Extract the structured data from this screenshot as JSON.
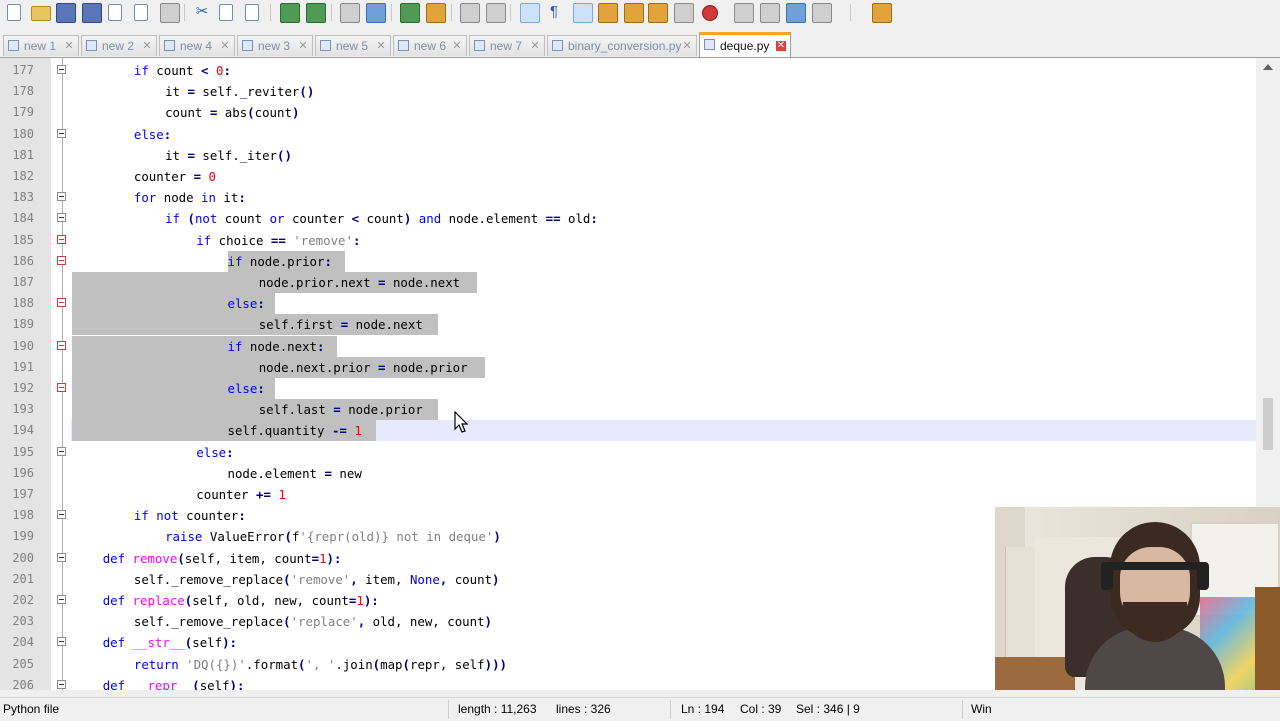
{
  "tabs": [
    {
      "label": "new 1",
      "active": false
    },
    {
      "label": "new 2",
      "active": false
    },
    {
      "label": "new 4",
      "active": false
    },
    {
      "label": "new 3",
      "active": false
    },
    {
      "label": "new 5",
      "active": false
    },
    {
      "label": "new 6",
      "active": false
    },
    {
      "label": "new 7",
      "active": false
    },
    {
      "label": "binary_conversion.py",
      "active": false
    },
    {
      "label": "deque.py",
      "active": true
    }
  ],
  "editor": {
    "current_line": 194,
    "selection_lines": [
      186,
      194
    ],
    "lines": [
      {
        "num": "177",
        "fold": true,
        "foldColor": "gray",
        "indent": 8,
        "tokens": [
          [
            "kw",
            "if"
          ],
          [
            "t",
            " count "
          ],
          [
            "op",
            "<"
          ],
          [
            "t",
            " "
          ],
          [
            "num",
            "0"
          ],
          [
            "op",
            ":"
          ]
        ]
      },
      {
        "num": "178",
        "indent": 12,
        "tokens": [
          [
            "t",
            "it "
          ],
          [
            "op",
            "="
          ],
          [
            "t",
            " self."
          ],
          [
            "t",
            "_reviter"
          ],
          [
            "op",
            "()"
          ]
        ]
      },
      {
        "num": "179",
        "indent": 12,
        "tokens": [
          [
            "t",
            "count "
          ],
          [
            "op",
            "="
          ],
          [
            "t",
            " abs"
          ],
          [
            "op",
            "("
          ],
          [
            "t",
            "count"
          ],
          [
            "op",
            ")"
          ]
        ]
      },
      {
        "num": "180",
        "fold": true,
        "foldColor": "gray",
        "indent": 8,
        "tokens": [
          [
            "kw",
            "else"
          ],
          [
            "op",
            ":"
          ]
        ]
      },
      {
        "num": "181",
        "indent": 12,
        "tokens": [
          [
            "t",
            "it "
          ],
          [
            "op",
            "="
          ],
          [
            "t",
            " self."
          ],
          [
            "t",
            "_iter"
          ],
          [
            "op",
            "()"
          ]
        ]
      },
      {
        "num": "182",
        "indent": 8,
        "tokens": [
          [
            "t",
            "counter "
          ],
          [
            "op",
            "="
          ],
          [
            "t",
            " "
          ],
          [
            "num",
            "0"
          ]
        ]
      },
      {
        "num": "183",
        "fold": true,
        "foldColor": "gray",
        "indent": 8,
        "tokens": [
          [
            "kw",
            "for"
          ],
          [
            "t",
            " node "
          ],
          [
            "kw",
            "in"
          ],
          [
            "t",
            " it"
          ],
          [
            "op",
            ":"
          ]
        ]
      },
      {
        "num": "184",
        "fold": true,
        "foldColor": "gray",
        "indent": 12,
        "tokens": [
          [
            "kw",
            "if"
          ],
          [
            "t",
            " "
          ],
          [
            "op",
            "("
          ],
          [
            "kw",
            "not"
          ],
          [
            "t",
            " count "
          ],
          [
            "kw",
            "or"
          ],
          [
            "t",
            " counter "
          ],
          [
            "op",
            "<"
          ],
          [
            "t",
            " count"
          ],
          [
            "op",
            ")"
          ],
          [
            "t",
            " "
          ],
          [
            "kw",
            "and"
          ],
          [
            "t",
            " node.element "
          ],
          [
            "op",
            "=="
          ],
          [
            "t",
            " old"
          ],
          [
            "op",
            ":"
          ]
        ]
      },
      {
        "num": "185",
        "fold": true,
        "foldColor": "red",
        "indent": 16,
        "tokens": [
          [
            "kw",
            "if"
          ],
          [
            "t",
            " choice "
          ],
          [
            "op",
            "=="
          ],
          [
            "t",
            " "
          ],
          [
            "str",
            "'remove'"
          ],
          [
            "op",
            ":"
          ]
        ]
      },
      {
        "num": "186",
        "fold": true,
        "foldColor": "red",
        "indent": 20,
        "tokens": [
          [
            "kw",
            "if"
          ],
          [
            "t",
            " node.prior"
          ],
          [
            "op",
            ":"
          ]
        ]
      },
      {
        "num": "187",
        "indent": 24,
        "tokens": [
          [
            "t",
            "node.prior.next "
          ],
          [
            "op",
            "="
          ],
          [
            "t",
            " node.next"
          ]
        ]
      },
      {
        "num": "188",
        "fold": true,
        "foldColor": "red",
        "indent": 20,
        "tokens": [
          [
            "kw",
            "else"
          ],
          [
            "op",
            ":"
          ]
        ]
      },
      {
        "num": "189",
        "indent": 24,
        "tokens": [
          [
            "t",
            "self.first "
          ],
          [
            "op",
            "="
          ],
          [
            "t",
            " node.next"
          ]
        ]
      },
      {
        "num": "190",
        "fold": true,
        "foldColor": "red",
        "indent": 20,
        "tokens": [
          [
            "kw",
            "if"
          ],
          [
            "t",
            " node.next"
          ],
          [
            "op",
            ":"
          ]
        ]
      },
      {
        "num": "191",
        "indent": 24,
        "tokens": [
          [
            "t",
            "node.next.prior "
          ],
          [
            "op",
            "="
          ],
          [
            "t",
            " node.prior"
          ]
        ]
      },
      {
        "num": "192",
        "fold": true,
        "foldColor": "red",
        "indent": 20,
        "tokens": [
          [
            "kw",
            "else"
          ],
          [
            "op",
            ":"
          ]
        ]
      },
      {
        "num": "193",
        "indent": 24,
        "tokens": [
          [
            "t",
            "self.last "
          ],
          [
            "op",
            "="
          ],
          [
            "t",
            " node.prior"
          ]
        ]
      },
      {
        "num": "194",
        "indent": 20,
        "tokens": [
          [
            "t",
            "self.quantity "
          ],
          [
            "op",
            "-="
          ],
          [
            "t",
            " "
          ],
          [
            "num",
            "1"
          ]
        ]
      },
      {
        "num": "195",
        "fold": true,
        "foldColor": "gray",
        "indent": 16,
        "tokens": [
          [
            "kw",
            "else"
          ],
          [
            "op",
            ":"
          ]
        ]
      },
      {
        "num": "196",
        "indent": 20,
        "tokens": [
          [
            "t",
            "node.element "
          ],
          [
            "op",
            "="
          ],
          [
            "t",
            " new"
          ]
        ]
      },
      {
        "num": "197",
        "indent": 16,
        "tokens": [
          [
            "t",
            "counter "
          ],
          [
            "op",
            "+="
          ],
          [
            "t",
            " "
          ],
          [
            "num",
            "1"
          ]
        ]
      },
      {
        "num": "198",
        "fold": true,
        "foldColor": "gray",
        "indent": 8,
        "tokens": [
          [
            "kw",
            "if"
          ],
          [
            "t",
            " "
          ],
          [
            "kw",
            "not"
          ],
          [
            "t",
            " counter"
          ],
          [
            "op",
            ":"
          ]
        ]
      },
      {
        "num": "199",
        "indent": 12,
        "tokens": [
          [
            "kw",
            "raise"
          ],
          [
            "t",
            " ValueError"
          ],
          [
            "op",
            "("
          ],
          [
            "t",
            "f"
          ],
          [
            "str",
            "'{repr(old)} not in deque'"
          ],
          [
            "op",
            ")"
          ]
        ]
      },
      {
        "num": "200",
        "fold": true,
        "foldColor": "gray",
        "indent": 4,
        "tokens": [
          [
            "kw",
            "def"
          ],
          [
            "t",
            " "
          ],
          [
            "fn",
            "remove"
          ],
          [
            "op",
            "("
          ],
          [
            "t",
            "self, item, count"
          ],
          [
            "op",
            "="
          ],
          [
            "num",
            "1"
          ],
          [
            "op",
            "):"
          ]
        ]
      },
      {
        "num": "201",
        "indent": 8,
        "tokens": [
          [
            "t",
            "self._remove_replace"
          ],
          [
            "op",
            "("
          ],
          [
            "str",
            "'remove'"
          ],
          [
            "op",
            ","
          ],
          [
            "t",
            " item, "
          ],
          [
            "kw",
            "None"
          ],
          [
            "op",
            ","
          ],
          [
            "t",
            " count"
          ],
          [
            "op",
            ")"
          ]
        ]
      },
      {
        "num": "202",
        "fold": true,
        "foldColor": "gray",
        "indent": 4,
        "tokens": [
          [
            "kw",
            "def"
          ],
          [
            "t",
            " "
          ],
          [
            "fn",
            "replace"
          ],
          [
            "op",
            "("
          ],
          [
            "t",
            "self, old, new, count"
          ],
          [
            "op",
            "="
          ],
          [
            "num",
            "1"
          ],
          [
            "op",
            "):"
          ]
        ]
      },
      {
        "num": "203",
        "indent": 8,
        "tokens": [
          [
            "t",
            "self._remove_replace"
          ],
          [
            "op",
            "("
          ],
          [
            "str",
            "'replace'"
          ],
          [
            "op",
            ","
          ],
          [
            "t",
            " old, new, count"
          ],
          [
            "op",
            ")"
          ]
        ]
      },
      {
        "num": "204",
        "fold": true,
        "foldColor": "gray",
        "indent": 4,
        "tokens": [
          [
            "kw",
            "def"
          ],
          [
            "t",
            " "
          ],
          [
            "fn",
            "__str__"
          ],
          [
            "op",
            "("
          ],
          [
            "t",
            "self"
          ],
          [
            "op",
            "):"
          ]
        ]
      },
      {
        "num": "205",
        "indent": 8,
        "tokens": [
          [
            "kw",
            "return"
          ],
          [
            "t",
            " "
          ],
          [
            "str",
            "'DQ({})'"
          ],
          [
            "t",
            "."
          ],
          [
            "t",
            "format"
          ],
          [
            "op",
            "("
          ],
          [
            "str",
            "', '"
          ],
          [
            "t",
            ".join"
          ],
          [
            "op",
            "("
          ],
          [
            "t",
            "map"
          ],
          [
            "op",
            "("
          ],
          [
            "t",
            "repr, self"
          ],
          [
            "op",
            ")))"
          ]
        ]
      },
      {
        "num": "206",
        "fold": true,
        "foldColor": "gray",
        "indent": 4,
        "tokens": [
          [
            "kw",
            "def"
          ],
          [
            "t",
            " "
          ],
          [
            "fn",
            "__repr__"
          ],
          [
            "op",
            "("
          ],
          [
            "t",
            "self"
          ],
          [
            "op",
            "):"
          ]
        ]
      }
    ]
  },
  "status": {
    "file_type": "Python file",
    "length": "length : 11,263",
    "lines": "lines : 326",
    "ln": "Ln : 194",
    "col": "Col : 39",
    "sel": "Sel : 346 | 9",
    "eol": "Win"
  },
  "icons": {
    "tab_file": "file-icon",
    "tab_close": "close-icon",
    "cursor": "mouse-pointer-icon"
  },
  "colors": {
    "keyword": "#0000ff",
    "number": "#ff0000",
    "string": "#808080",
    "function": "#ff00ff",
    "selection": "#c0c0c0",
    "active_tab_accent": "#f5a623"
  }
}
